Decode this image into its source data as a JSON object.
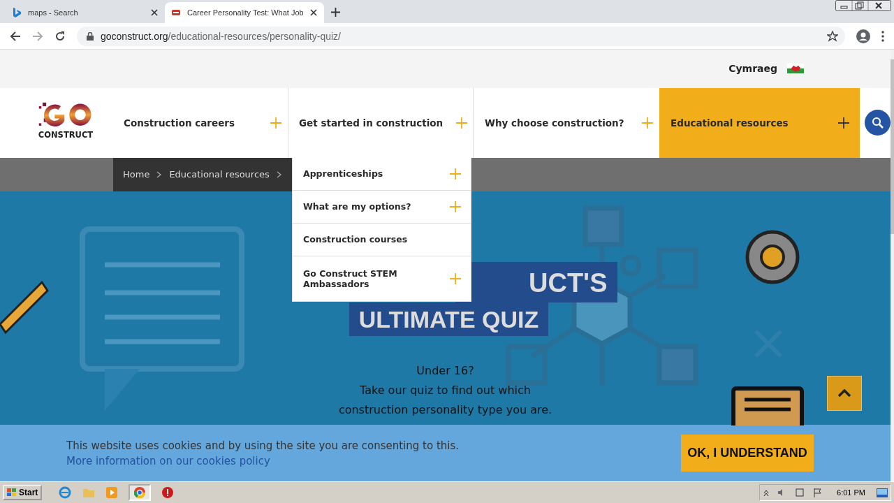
{
  "browser": {
    "tabs": [
      {
        "title": "maps - Search",
        "selected": false
      },
      {
        "title": "Career Personality Test: What Job",
        "selected": true
      }
    ],
    "url": {
      "host": "goconstruct.org",
      "path": "/educational-resources/personality-quiz/"
    }
  },
  "language": {
    "label": "Cymraeg"
  },
  "logo": {
    "text": "CONSTRUCT"
  },
  "nav": {
    "items": [
      {
        "label": "Construction careers",
        "selected": false,
        "expanded": false
      },
      {
        "label": "Get started in construction",
        "selected": false,
        "expanded": true
      },
      {
        "label": "Why choose construction?",
        "selected": false,
        "expanded": false
      },
      {
        "label": "Educational resources",
        "selected": true,
        "expanded": false
      }
    ],
    "dropdown": [
      {
        "label": "Apprenticeships",
        "expandable": true
      },
      {
        "label": "What are my options?",
        "expandable": true
      },
      {
        "label": "Construction courses",
        "expandable": false
      },
      {
        "label": "Go Construct STEM Ambassadors",
        "expandable": true
      }
    ]
  },
  "breadcrumb": [
    {
      "label": "Home"
    },
    {
      "label": "Educational resources"
    }
  ],
  "hero": {
    "title_lines": [
      "UCT'S",
      "ULTIMATE QUIZ"
    ],
    "lines": [
      "Under 16?",
      "Take our quiz to find out which",
      "construction personality type you are."
    ]
  },
  "cookie_banner": {
    "text": "This website uses cookies and by using the site you are consenting to this.",
    "link": "More information on our cookies policy",
    "button": "OK, I UNDERSTAND"
  },
  "taskbar": {
    "start": "Start",
    "time": "6:01 PM"
  }
}
